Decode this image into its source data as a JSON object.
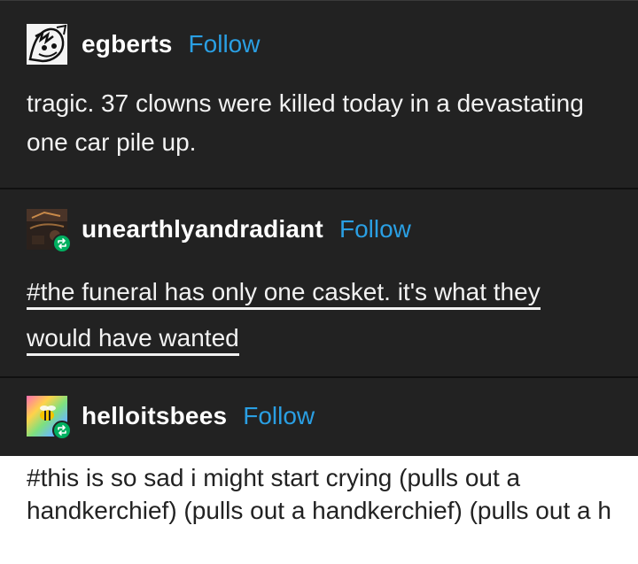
{
  "posts": [
    {
      "username": "egberts",
      "follow_label": "Follow",
      "avatar_icon": "bw-sketch-avatar-icon",
      "text": "tragic. 37 clowns were killed today in a devastating one car pile up."
    },
    {
      "username": "unearthlyandradiant",
      "follow_label": "Follow",
      "avatar_icon": "dark-photo-avatar-icon",
      "reblog_icon": "reblog-icon",
      "tag_lines": [
        "#the funeral has only one casket. it's what they",
        "would have wanted"
      ]
    },
    {
      "username": "helloitsbees",
      "follow_label": "Follow",
      "avatar_icon": "rainbow-bee-avatar-icon",
      "reblog_icon": "reblog-icon"
    }
  ],
  "bottom_tags": "#this is so sad i might start crying (pulls out a handkerchief) (pulls out a handkerchief) (pulls out a h",
  "colors": {
    "background": "#222222",
    "follow_link": "#2a9fe3",
    "reblog_badge": "#00b060",
    "bottom_card": "#ffffff"
  }
}
